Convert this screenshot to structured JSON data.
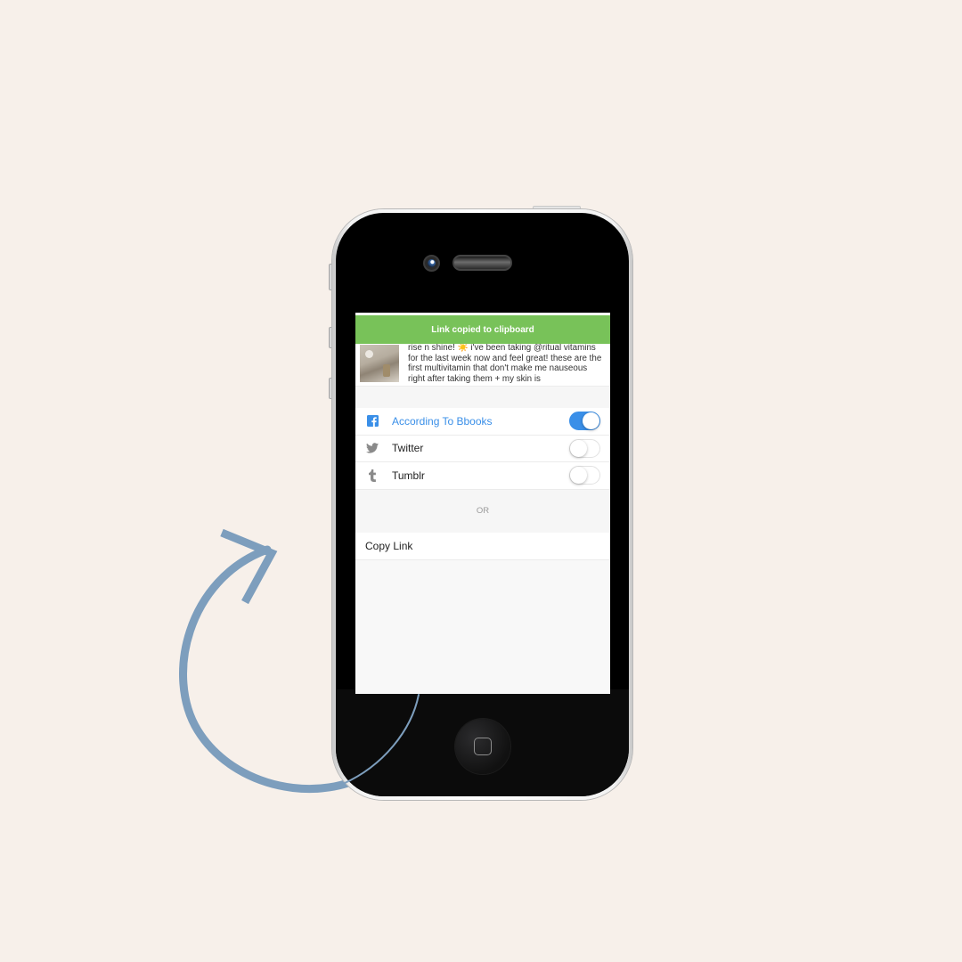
{
  "colors": {
    "background": "#f7f0ea",
    "toast": "#78c259",
    "accent": "#3a8fe8",
    "arrow": "#7d9ebd"
  },
  "toast": {
    "text": "Link copied to clipboard"
  },
  "post": {
    "thumbnail": "post-photo",
    "text": "rise n shine! ☀️ i've been taking @ritual vitamins for the last week now and feel great! these are the first multivitamin that don't make me nauseous right after taking them + my skin is"
  },
  "share": {
    "items": [
      {
        "icon": "facebook-icon",
        "label": "According To Bbooks",
        "enabled": true
      },
      {
        "icon": "twitter-icon",
        "label": "Twitter",
        "enabled": false
      },
      {
        "icon": "tumblr-icon",
        "label": "Tumblr",
        "enabled": false
      }
    ]
  },
  "divider": {
    "text": "OR"
  },
  "copy_link": {
    "label": "Copy Link"
  },
  "decoration": {
    "arrow_icon": "curved-arrow-icon"
  }
}
